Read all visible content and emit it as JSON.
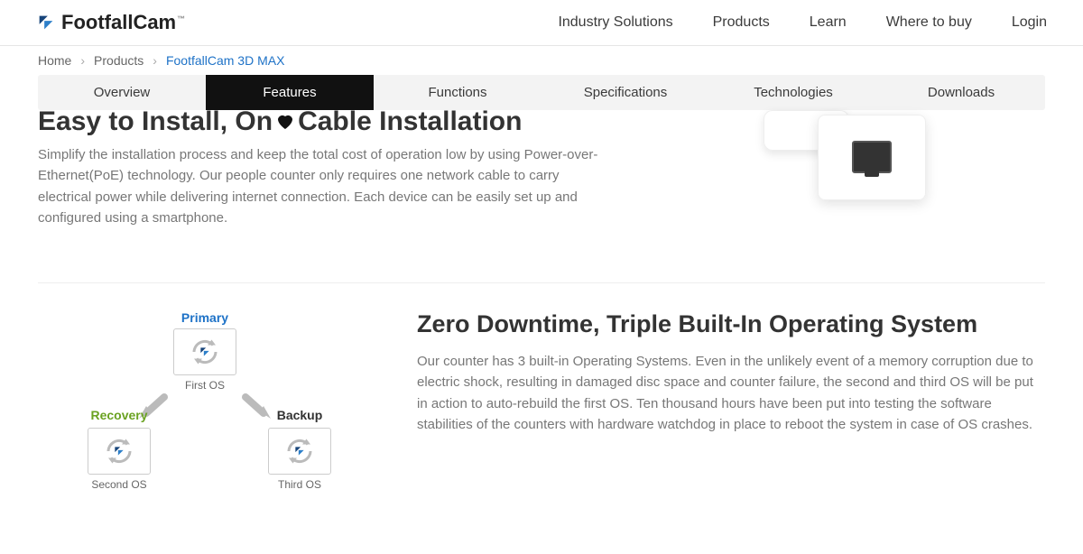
{
  "logo": {
    "text": "FootfallCam",
    "bold_part": "Footfall",
    "thin_part": "Cam",
    "tm": "™"
  },
  "main_nav": [
    "Industry Solutions",
    "Products",
    "Learn",
    "Where to buy",
    "Login"
  ],
  "breadcrumb": {
    "items": [
      "Home",
      "Products",
      "FootfallCam 3D MAX"
    ]
  },
  "subnav": {
    "items": [
      "Overview",
      "Features",
      "Functions",
      "Specifications",
      "Technologies",
      "Downloads"
    ],
    "active_index": 1
  },
  "section1": {
    "heading_pre": "Easy to Install, On",
    "heading_post": "Cable Installation",
    "body": "Simplify the installation process and keep the total cost of operation low by using Power-over-Ethernet(PoE) technology. Our people counter only requires one network cable to carry electrical power while delivering internet connection. Each device can be easily set up and configured using a smartphone."
  },
  "diagram": {
    "primary_label": "Primary",
    "primary_sub": "First OS",
    "recovery_label": "Recovery",
    "recovery_sub": "Second OS",
    "backup_label": "Backup",
    "backup_sub": "Third OS"
  },
  "section2": {
    "heading": "Zero Downtime, Triple Built-In Operating System",
    "body": "Our counter has 3 built-in Operating Systems. Even in the unlikely event of a memory corruption due to electric shock, resulting in damaged disc space and counter failure, the second and third OS will be put in action to auto-rebuild the first OS. Ten thousand hours have been put into testing the software stabilities of the counters with hardware watchdog in place to reboot the system in case of OS crashes."
  }
}
